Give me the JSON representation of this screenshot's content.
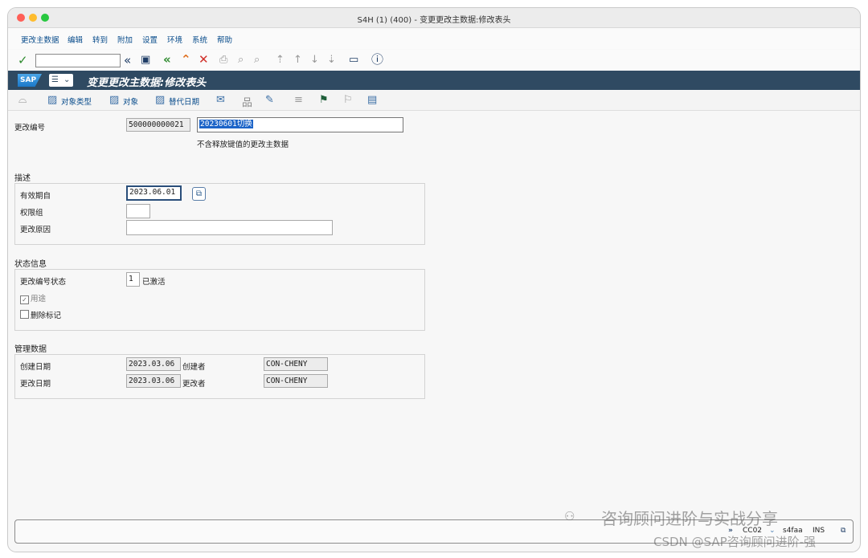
{
  "window": {
    "title": "S4H (1) (400) - 变更更改主数据:修改表头"
  },
  "menu": [
    {
      "label": "更改主数据"
    },
    {
      "label": "编辑"
    },
    {
      "label": "转到"
    },
    {
      "label": "附加"
    },
    {
      "label": "设置"
    },
    {
      "label": "环境"
    },
    {
      "label": "系统"
    },
    {
      "label": "帮助"
    }
  ],
  "command_field": {
    "value": ""
  },
  "title_bar": {
    "title": "变更更改主数据:修改表头",
    "logo": "SAP"
  },
  "app_toolbar": {
    "object_types": "对象类型",
    "objects": "对象",
    "alt_dates": "替代日期"
  },
  "change_number": {
    "label": "更改编号",
    "number": "500000000021",
    "description": "20230601切换",
    "hint": "不含释放键值的更改主数据"
  },
  "description_group": {
    "title": "描述",
    "valid_from_label": "有效期自",
    "valid_from": "2023.06.01",
    "auth_group_label": "权限组",
    "auth_group": "",
    "reason_label": "更改原因",
    "reason": ""
  },
  "status_group": {
    "title": "状态信息",
    "status_label": "更改编号状态",
    "status_value": "1",
    "status_text": "已激活",
    "usage_label": "用途",
    "usage_checked": true,
    "delete_label": "删除标记",
    "delete_checked": false
  },
  "admin_group": {
    "title": "管理数据",
    "created_on_label": "创建日期",
    "created_on": "2023.03.06",
    "created_by_label": "创建者",
    "created_by": "CON-CHENY",
    "changed_on_label": "更改日期",
    "changed_on": "2023.03.06",
    "changed_by_label": "更改者",
    "changed_by": "CON-CHENY"
  },
  "status_bar": {
    "transaction": "CC02",
    "server": "s4faa",
    "mode": "INS"
  },
  "watermark": {
    "line1": "咨询顾问进阶与实战分享",
    "line2": "CSDN @SAP咨询顾问进阶-强"
  },
  "colors": {
    "title_bar_bg": "#2f4a62",
    "menu_text": "#0a4d8c",
    "selection": "#1c64c8"
  }
}
